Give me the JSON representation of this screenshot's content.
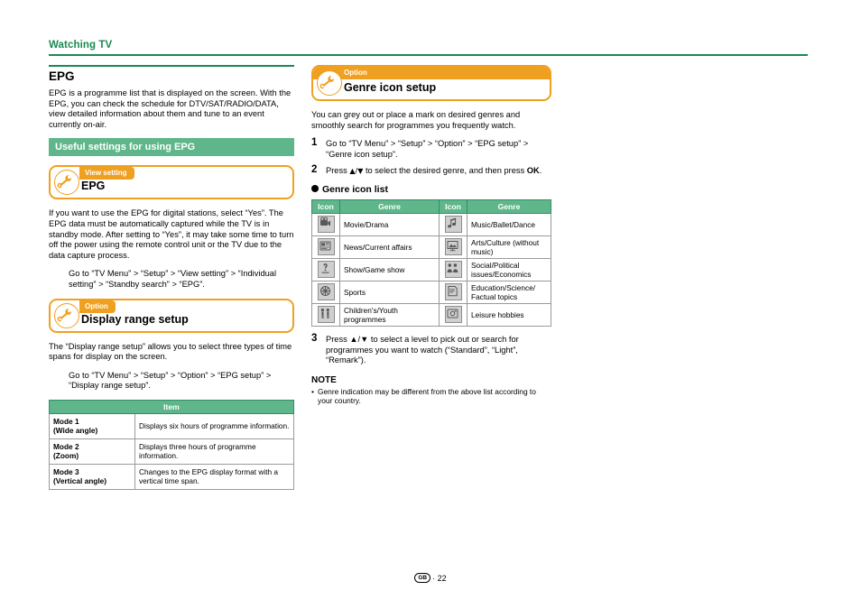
{
  "header": {
    "title": "Watching TV"
  },
  "left": {
    "section_title": "EPG",
    "intro": "EPG is a programme list that is displayed on the screen. With the EPG, you can check the schedule for DTV/SAT/RADIO/DATA, view detailed information about them and tune to an event currently on-air.",
    "green_bar": "Useful settings for using EPG",
    "box1": {
      "tab": "View setting",
      "title": "EPG",
      "icon": "wrench-icon"
    },
    "box1_body": "If you want to use the EPG for digital stations, select “Yes”. The EPG data must be automatically captured while the TV is in standby mode. After setting to “Yes”, it may take some time to turn off the power using the remote control unit or the TV due to the data capture process.",
    "box1_goto": "Go to “TV Menu” > “Setup” > “View setting” > “Individual setting” > “Standby search” > “EPG”.",
    "box2": {
      "tab": "Option",
      "title": "Display range setup",
      "icon": "wrench-icon"
    },
    "box2_body": "The “Display range setup” allows you to select three types of time spans for display on the screen.",
    "box2_goto": "Go to “TV Menu” > “Setup” > “Option” > “EPG setup” > “Display range setup”.",
    "table": {
      "header": "Item",
      "rows": [
        {
          "mode": "Mode 1",
          "mode2": "(Wide angle)",
          "desc": "Displays six hours of programme information."
        },
        {
          "mode": "Mode 2",
          "mode2": "(Zoom)",
          "desc": "Displays three hours of programme information."
        },
        {
          "mode": "Mode 3",
          "mode2": "(Vertical angle)",
          "desc": "Changes to the EPG display format with a vertical time span."
        }
      ]
    }
  },
  "right": {
    "box": {
      "tab": "Option",
      "title": "Genre icon setup",
      "icon": "wrench-icon"
    },
    "intro": "You can grey out or place a mark on desired genres and smoothly search for programmes you frequently watch.",
    "steps": [
      {
        "num": "1",
        "text": "Go to “TV Menu” > “Setup” > “Option” > “EPG setup” > “Genre icon setup”."
      },
      {
        "num": "2",
        "text_pre": "Press ",
        "arrows": "▲/▼",
        "text_mid": " to select the desired genre, and then press ",
        "bold": "OK",
        "text_post": "."
      },
      {
        "num": "3",
        "text": "Press ▲/▼ to select a level to pick out or search for programmes you want to watch (“Standard”, “Light”, “Remark”)."
      }
    ],
    "genre_list_heading": "Genre icon list",
    "genre_table": {
      "headers": [
        "Icon",
        "Genre",
        "Icon",
        "Genre"
      ],
      "rows": [
        {
          "icon_left": "movie-drama-icon",
          "genre_left": "Movie/Drama",
          "icon_right": "music-ballet-dance-icon",
          "genre_right": "Music/Ballet/Dance"
        },
        {
          "icon_left": "news-current-affairs-icon",
          "genre_left": "News/Current affairs",
          "icon_right": "arts-culture-icon",
          "genre_right": "Arts/Culture (without music)"
        },
        {
          "icon_left": "show-game-show-icon",
          "genre_left": "Show/Game show",
          "icon_right": "social-political-icon",
          "genre_right": "Social/Political issues/Economics"
        },
        {
          "icon_left": "sports-icon",
          "genre_left": "Sports",
          "icon_right": "education-science-icon",
          "genre_right": "Education/Science/ Factual topics"
        },
        {
          "icon_left": "childrens-youth-icon",
          "genre_left": "Children's/Youth programmes",
          "icon_right": "leisure-hobbies-icon",
          "genre_right": "Leisure hobbies"
        }
      ]
    },
    "note_heading": "NOTE",
    "note_text": "Genre indication may be different from the above list according to your country."
  },
  "footer": {
    "badge": "GB",
    "page": "· 22"
  },
  "colors": {
    "green": "#1a8a52",
    "green_bar": "#5fb68a",
    "orange": "#f0a020"
  }
}
